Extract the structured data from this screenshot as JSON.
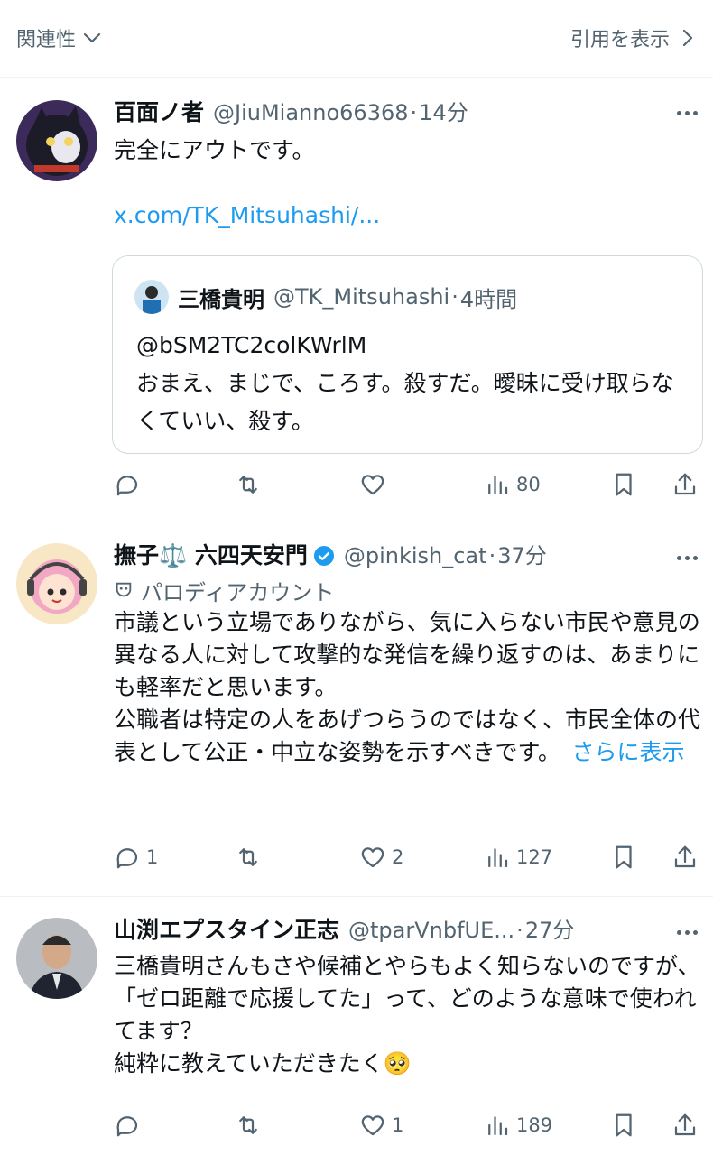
{
  "header": {
    "sort_label": "関連性",
    "quotes_link": "引用を表示"
  },
  "posts": [
    {
      "name": "百面ノ者",
      "handle": "@JiuMianno66368",
      "time": "14分",
      "text": "完全にアウトです。",
      "link": "x.com/TK_Mitsuhashi/...",
      "quote": {
        "name": "三橋貴明",
        "handle": "@TK_Mitsuhashi",
        "time": "4時間",
        "text": "@bSM2TC2colKWrlM\nおまえ、まじで、ころす。殺すだ。曖昧に受け取らなくていい、殺す。"
      },
      "replies": "",
      "reposts": "",
      "likes": "",
      "views": "80"
    },
    {
      "name": "撫子⚖️ 六四天安門",
      "handle": "@pinkish_cat",
      "time": "37分",
      "badge": "パロディアカウント",
      "text": "市議という立場でありながら、気に入らない市民や意見の異なる人に対して攻撃的な発信を繰り返すのは、あまりにも軽率だと思います。\n公職者は特定の人をあげつらうのではなく、市民全体の代表として公正・中立な姿勢を示すべきです。",
      "show_more": "さらに表示",
      "replies": "1",
      "reposts": "",
      "likes": "2",
      "views": "127"
    },
    {
      "name": "山渕エプスタイン正志",
      "handle": "@tparVnbfUE...",
      "time": "27分",
      "text": "三橋貴明さんもさや候補とやらもよく知らないのですが、「ゼロ距離で応援してた」って、どのような意味で使われてます？\n純粋に教えていただきたく🥺",
      "replies": "",
      "reposts": "",
      "likes": "1",
      "views": "189"
    }
  ],
  "colors": {
    "text": "#0f1419",
    "secondary": "#536471",
    "link": "#1d9bf0",
    "verified": "#1d9bf0",
    "border": "#eff3f4"
  }
}
